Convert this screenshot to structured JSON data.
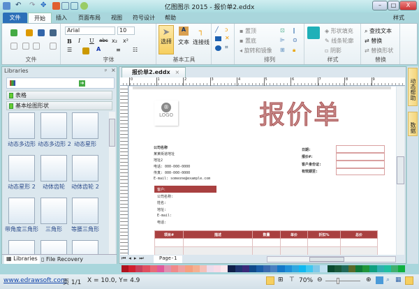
{
  "window": {
    "title": "亿图图示 2015 - 报价单2.eddx",
    "min": "–",
    "max": "□",
    "close": "X"
  },
  "tabs": [
    "文件",
    "开始",
    "插入",
    "页面布局",
    "视图",
    "符号设计",
    "帮助"
  ],
  "style_menu": "样式",
  "ribbon": {
    "file_group": "文件",
    "font": {
      "label": "字体",
      "family": "Arial",
      "size": "10",
      "bold": "B",
      "italic": "I",
      "underline": "U",
      "strike": "abc",
      "sub": "x₂",
      "sup": "x²"
    },
    "tools": {
      "label": "基本工具",
      "select": "选择",
      "text": "文本",
      "connector": "连接线"
    },
    "arrange": {
      "label": "排列",
      "top": "置顶",
      "bottom": "置底",
      "rotate": "旋转和镜像"
    },
    "style": {
      "label": "样式",
      "fill": "形状填充",
      "line": "线条轮廓",
      "shadow": "阴影"
    },
    "replace": {
      "label": "替换",
      "find": "查找文本",
      "replace": "替换",
      "replace_shape": "替换形状"
    }
  },
  "libraries": {
    "title": "Libraries",
    "sections": [
      "表格",
      "基本绘图形状"
    ],
    "shapes": [
      "动态多边形",
      "动态多边形 2",
      "动态星形",
      "动态星形 2",
      "动体齿轮",
      "动体齿轮 2",
      "带角度三角形",
      "三角形",
      "等腰三角形"
    ],
    "bottom_tabs": [
      "Libraries",
      "File Recovery"
    ]
  },
  "document": {
    "tab": "报价单2.eddx",
    "ruler": [
      "0",
      "1",
      "2",
      "3",
      "4",
      "5",
      "6",
      "7",
      "8",
      "9"
    ],
    "heading": "报价单",
    "logo": "LOGO",
    "company": [
      "公司名称",
      "某某街道地址",
      "地址2",
      "电话: 000-000-0000",
      "传真: 000-000-0000",
      "E-mail: someone@example.com"
    ],
    "right_labels": [
      "日期:",
      "报价#:",
      "客户身份证:",
      "有效期至:"
    ],
    "customer_header": "客户:",
    "customer_fields": [
      "公司名称:",
      "姓名:",
      "地址:",
      "E-mail:",
      "电话:"
    ],
    "table_headers": [
      "项目#",
      "描述",
      "数量",
      "单价",
      "折扣%",
      "总价"
    ],
    "page_tab": "Page-1"
  },
  "right_panel": [
    "动态帮助",
    "数据"
  ],
  "palette": [
    "#b0121d",
    "#d2202f",
    "#c8405a",
    "#e05060",
    "#e86a78",
    "#e05a9a",
    "#e090b0",
    "#f08a8a",
    "#f0a0a0",
    "#f5a080",
    "#f5b090",
    "#f5c0b8",
    "#ecdcec",
    "#f8dce8",
    "#fbe8ee",
    "#10204a",
    "#1f3570",
    "#3b2a7a",
    "#0f4a8a",
    "#1a5ea8",
    "#3a6ab0",
    "#4a80c0",
    "#1478c8",
    "#2090d8",
    "#30a8e0",
    "#10b8f0",
    "#40c8f0",
    "#80c8e8",
    "#c0e0f0",
    "#0a4a30",
    "#1a5a3a",
    "#206a5a",
    "#5a6a2a",
    "#107a3a",
    "#20963a",
    "#10a080",
    "#30b0b0",
    "#20c0a0",
    "#40b070",
    "#10b040"
  ],
  "status": {
    "link": "www.edrawsoft.com",
    "page": "页 1/1",
    "coords": "X = 10.0, Y= 4.9",
    "zoom": "70%",
    "zoom_level": 0.35
  }
}
